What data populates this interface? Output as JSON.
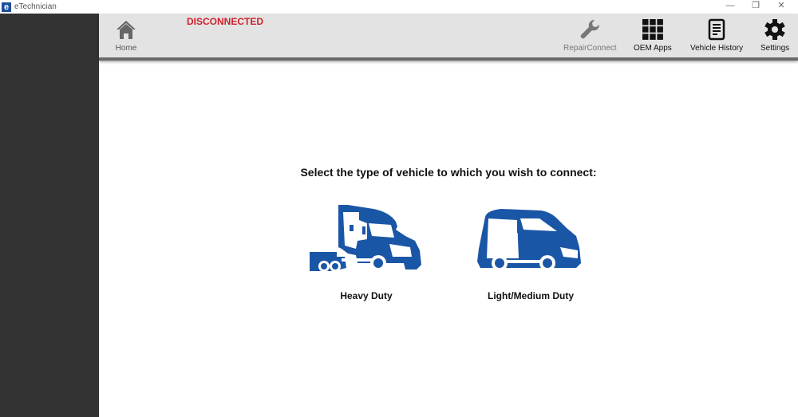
{
  "window": {
    "title": "eTechnician",
    "logo_letter": "e",
    "minimize": "—",
    "restore": "❐",
    "close": "✕"
  },
  "toolbar": {
    "home": "Home",
    "status": "DISCONNECTED",
    "repair_connect": "RepairConnect",
    "oem_apps": "OEM Apps",
    "vehicle_history": "Vehicle History",
    "settings": "Settings"
  },
  "main": {
    "prompt": "Select the type of vehicle to which you wish to connect:",
    "options": [
      {
        "label": "Heavy Duty"
      },
      {
        "label": "Light/Medium Duty"
      }
    ]
  },
  "colors": {
    "brand_blue": "#1a56a6",
    "status_red": "#d0202a",
    "sidebar": "#333333",
    "toolbar": "#e3e3e3"
  }
}
